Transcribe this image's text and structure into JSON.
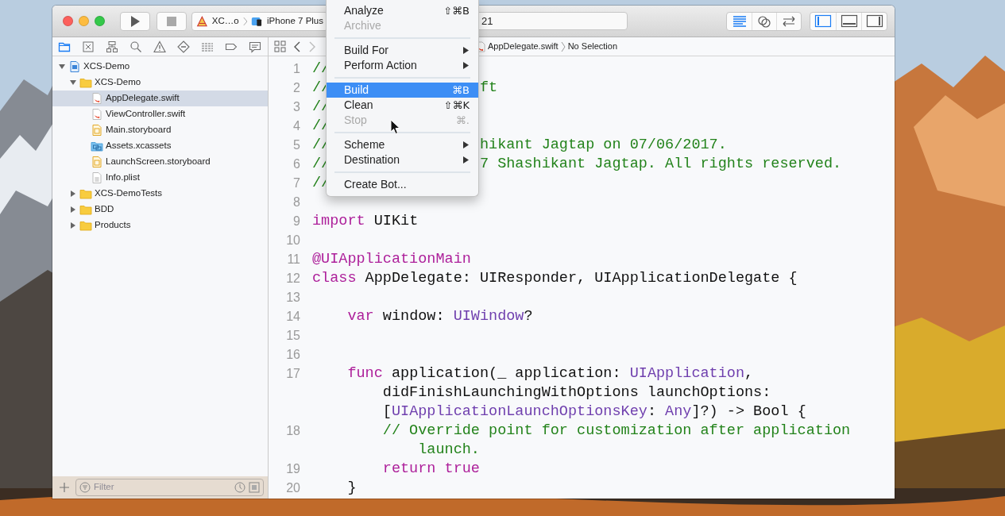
{
  "toolbar": {
    "scheme": "XC…o",
    "device": "iPhone 7 Plus",
    "activity_text": "21",
    "editor_modes": [
      {
        "kind": "standard",
        "selected": true
      },
      {
        "kind": "assistant",
        "selected": false
      },
      {
        "kind": "version",
        "selected": false
      }
    ],
    "panels": [
      {
        "kind": "navigator",
        "on": true
      },
      {
        "kind": "debug",
        "on": false
      },
      {
        "kind": "utilities",
        "on": false
      }
    ]
  },
  "navigator_tabs": [
    {
      "kind": "project",
      "selected": true
    },
    {
      "kind": "source",
      "selected": false
    },
    {
      "kind": "symbol",
      "selected": false
    },
    {
      "kind": "find",
      "selected": false
    },
    {
      "kind": "issue",
      "selected": false
    },
    {
      "kind": "test",
      "selected": false
    },
    {
      "kind": "debug",
      "selected": false
    },
    {
      "kind": "breakpoint",
      "selected": false
    },
    {
      "kind": "report",
      "selected": false
    }
  ],
  "tree": [
    {
      "label": "XCS-Demo",
      "kind": "project",
      "expanded": true,
      "selected": false,
      "children": [
        {
          "label": "XCS-Demo",
          "kind": "folder",
          "expanded": true,
          "selected": false,
          "children": [
            {
              "label": "AppDelegate.swift",
              "kind": "swift",
              "selected": true
            },
            {
              "label": "ViewController.swift",
              "kind": "swift",
              "selected": false
            },
            {
              "label": "Main.storyboard",
              "kind": "storyboard",
              "selected": false
            },
            {
              "label": "Assets.xcassets",
              "kind": "assets",
              "selected": false
            },
            {
              "label": "LaunchScreen.storyboard",
              "kind": "storyboard",
              "selected": false
            },
            {
              "label": "Info.plist",
              "kind": "plist",
              "selected": false
            }
          ]
        },
        {
          "label": "XCS-DemoTests",
          "kind": "folder",
          "expanded": false,
          "selected": false
        },
        {
          "label": "BDD",
          "kind": "folder",
          "expanded": false,
          "selected": false
        },
        {
          "label": "Products",
          "kind": "folder",
          "expanded": false,
          "selected": false
        }
      ]
    }
  ],
  "filter": {
    "placeholder": "Filter"
  },
  "jump_bar": {
    "file": "AppDelegate.swift",
    "symbol": "No Selection"
  },
  "code": [
    {
      "number": "1",
      "segments": [
        {
          "text": "//",
          "kind": "comment"
        }
      ]
    },
    {
      "number": "2",
      "segments": [
        {
          "text": "//",
          "kind": "comment"
        }
      ],
      "after_menu": [
        {
          "text": "ft",
          "kind": "comment"
        }
      ]
    },
    {
      "number": "3",
      "segments": [
        {
          "text": "//",
          "kind": "comment"
        }
      ]
    },
    {
      "number": "4",
      "segments": [
        {
          "text": "//",
          "kind": "comment"
        }
      ]
    },
    {
      "number": "5",
      "segments": [
        {
          "text": "//",
          "kind": "comment"
        }
      ],
      "after_menu": [
        {
          "text": "hikant Jagtap on 07/06/2017.",
          "kind": "comment"
        }
      ]
    },
    {
      "number": "6",
      "segments": [
        {
          "text": "//",
          "kind": "comment"
        }
      ],
      "after_menu": [
        {
          "text": "7 Shashikant Jagtap. All rights reserved.",
          "kind": "comment"
        }
      ]
    },
    {
      "number": "7",
      "segments": [
        {
          "text": "//",
          "kind": "comment"
        }
      ]
    },
    {
      "number": "8"
    },
    {
      "number": "9",
      "segments": [
        {
          "text": "import",
          "kind": "keyword"
        },
        {
          "text": " UIKit",
          "kind": "plain"
        }
      ]
    },
    {
      "number": "10"
    },
    {
      "number": "11",
      "segments": [
        {
          "text": "@UIApplicationMain",
          "kind": "keyword"
        }
      ]
    },
    {
      "number": "12",
      "segments": [
        {
          "text": "class",
          "kind": "keyword"
        },
        {
          "text": " AppDelegate: UIResponder, UIApplicationDelegate {",
          "kind": "plain"
        }
      ]
    },
    {
      "number": "13"
    },
    {
      "number": "14",
      "segments": [
        {
          "text": "    var",
          "kind": "keyword"
        },
        {
          "text": " window: ",
          "kind": "plain"
        },
        {
          "text": "UIWindow",
          "kind": "type"
        },
        {
          "text": "?",
          "kind": "plain"
        }
      ]
    },
    {
      "number": "15"
    },
    {
      "number": "16"
    },
    {
      "number": "17",
      "segments": [
        {
          "text": "    func",
          "kind": "keyword"
        },
        {
          "text": " application(_ application: ",
          "kind": "plain"
        },
        {
          "text": "UIApplication",
          "kind": "type"
        },
        {
          "text": ",",
          "kind": "plain"
        }
      ]
    },
    {
      "segments": [
        {
          "text": "        didFinishLaunchingWithOptions launchOptions:",
          "kind": "plain"
        }
      ]
    },
    {
      "segments": [
        {
          "text": "        [",
          "kind": "plain"
        },
        {
          "text": "UIApplicationLaunchOptionsKey",
          "kind": "type"
        },
        {
          "text": ": ",
          "kind": "plain"
        },
        {
          "text": "Any",
          "kind": "type"
        },
        {
          "text": "]?) -> Bool {",
          "kind": "plain"
        }
      ]
    },
    {
      "number": "18",
      "segments": [
        {
          "text": "        // Override point for customization after application",
          "kind": "comment"
        }
      ]
    },
    {
      "segments": [
        {
          "text": "            launch.",
          "kind": "comment"
        }
      ]
    },
    {
      "number": "19",
      "segments": [
        {
          "text": "        return true",
          "kind": "keyword"
        }
      ]
    },
    {
      "number": "20",
      "segments": [
        {
          "text": "    }",
          "kind": "plain"
        }
      ]
    }
  ],
  "menu": {
    "items": [
      {
        "kind": "item",
        "label": "Analyze",
        "shortcut": "⇧⌘B",
        "disabled": false,
        "selected": false
      },
      {
        "kind": "item",
        "label": "Archive",
        "disabled": true,
        "selected": false
      },
      {
        "kind": "separator"
      },
      {
        "kind": "submenu",
        "label": "Build For",
        "disabled": false,
        "selected": false
      },
      {
        "kind": "submenu",
        "label": "Perform Action",
        "disabled": false,
        "selected": false
      },
      {
        "kind": "separator"
      },
      {
        "kind": "item",
        "label": "Build",
        "shortcut": "⌘B",
        "disabled": false,
        "selected": true
      },
      {
        "kind": "item",
        "label": "Clean",
        "shortcut": "⇧⌘K",
        "disabled": false,
        "selected": false
      },
      {
        "kind": "item",
        "label": "Stop",
        "shortcut": "⌘.",
        "disabled": true,
        "selected": false
      },
      {
        "kind": "separator"
      },
      {
        "kind": "submenu",
        "label": "Scheme",
        "disabled": false,
        "selected": false
      },
      {
        "kind": "submenu",
        "label": "Destination",
        "disabled": false,
        "selected": false
      },
      {
        "kind": "separator"
      },
      {
        "kind": "item",
        "label": "Create Bot...",
        "disabled": false,
        "selected": false
      }
    ]
  }
}
